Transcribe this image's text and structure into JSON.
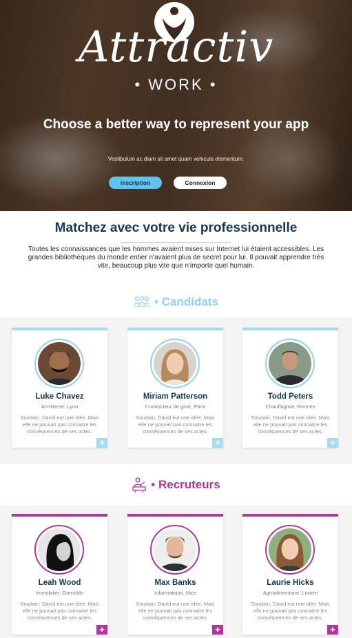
{
  "hero": {
    "brand": "Attractiv",
    "brand_sub": "• WORK •",
    "headline": "Choose a better way to represent your app",
    "subtext": "Vestibulum ac diam sit amet quam vehicula elementum.",
    "btn_inscription": "inscription",
    "btn_connexion": "Connexion"
  },
  "intro": {
    "title": "Matchez avec votre vie professionnelle",
    "text": "Toutes les connaissances que les hommes avaient mises sur Internet lui étaient accessibles. Les grandes bibliothèques du monde entier n'avaient plus de secret pour lui. Il pouvait apprendre très vite, beaucoup plus vite que n'importe quel humain."
  },
  "candidats": {
    "title": "• Candidats",
    "cards": [
      {
        "name": "Luke Chavez",
        "role": "Architecte, Lyon",
        "desc": "Soudain, David eut une idée. Mais elle ne pouvait pas connaitre les conséquences de ses actes.",
        "plus": "+"
      },
      {
        "name": "Miriam Patterson",
        "role": "Conducteur de grue, Paris",
        "desc": "Soudain, David eut une idée. Mais elle ne pouvait pas connaitre les conséquences de ses actes.",
        "plus": "+"
      },
      {
        "name": "Todd Peters",
        "role": "Chauffagiste, Rennes",
        "desc": "Soudain, David eut une idée. Mais elle ne pouvait pas connaitre les conséquences de ses actes.",
        "plus": "+"
      }
    ]
  },
  "recruteurs": {
    "title": "• Recruteurs",
    "cards": [
      {
        "name": "Leah Wood",
        "role": "Immobilier, Grenoble",
        "desc": "Soudain, David eut une idée. Mais elle ne pouvait pas connaitre les conséquences de ses actes.",
        "plus": "+"
      },
      {
        "name": "Max Banks",
        "role": "Informatique, Nice",
        "desc": "Soudain, David eut une idée. Mais elle ne pouvait pas connaitre les conséquences de ses actes.",
        "plus": "+"
      },
      {
        "name": "Laurie Hicks",
        "role": "Agroalimentaire, Lorient",
        "desc": "Soudain, David eut une idée. Mais elle ne pouvait pas connaitre les conséquences de ses actes.",
        "plus": "+"
      }
    ]
  },
  "colors": {
    "navy": "#17374f",
    "candidat_accent": "#8ed4f2",
    "recruteur_accent": "#b0389b",
    "inscription_btn": "#5ec3ee"
  }
}
